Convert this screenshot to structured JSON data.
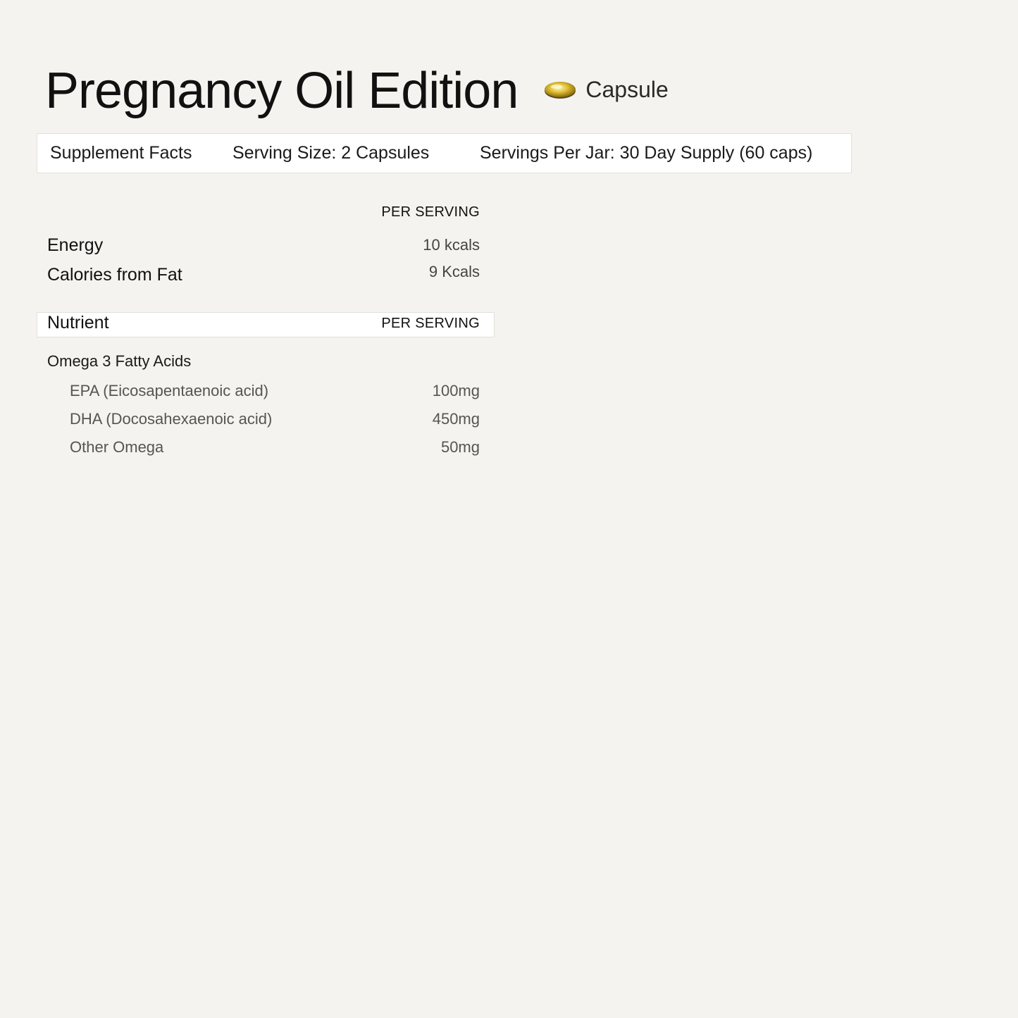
{
  "product": {
    "title": "Pregnancy Oil Edition",
    "format_label": "Capsule",
    "format_icon": "capsule-icon"
  },
  "facts_bar": {
    "title": "Supplement Facts",
    "serving_size": "Serving Size: 2 Capsules",
    "servings_per_jar": "Servings Per Jar:  30 Day Supply (60 caps)"
  },
  "energy": {
    "column_header": "PER SERVING",
    "rows": [
      {
        "label": "Energy",
        "value": "10 kcals"
      },
      {
        "label": "Calories from Fat",
        "value": "9 Kcals"
      }
    ]
  },
  "nutrients": {
    "header_label": "Nutrient",
    "column_header": "PER SERVING",
    "group": "Omega 3 Fatty Acids",
    "rows": [
      {
        "label": "EPA (Eicosapentaenoic acid)",
        "value": "100mg"
      },
      {
        "label": "DHA (Docosahexaenoic acid)",
        "value": "450mg"
      },
      {
        "label": "Other Omega",
        "value": "50mg"
      }
    ]
  },
  "colors": {
    "background": "#f4f3ef",
    "capsule_gold": "#d4b21c"
  }
}
